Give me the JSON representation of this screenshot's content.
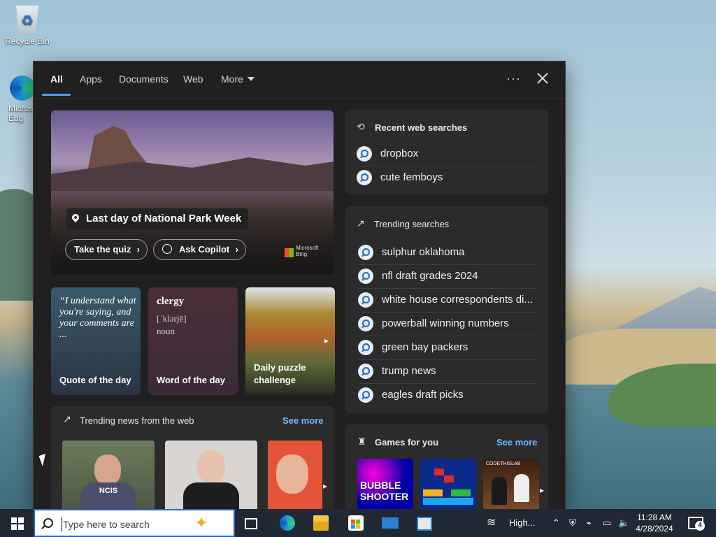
{
  "desktop": {
    "icons": [
      {
        "label": "Recycle Bin",
        "icon": "recycle-bin-icon"
      },
      {
        "label": "Microsoft Edge",
        "visible_text": "Micros\nEdg",
        "icon": "edge-icon"
      }
    ]
  },
  "search_panel": {
    "tabs": [
      {
        "label": "All",
        "active": true
      },
      {
        "label": "Apps"
      },
      {
        "label": "Documents"
      },
      {
        "label": "Web"
      },
      {
        "label": "More"
      }
    ],
    "more_options_glyph": "···",
    "hero": {
      "title": "Last day of National Park Week",
      "buttons": [
        {
          "label": "Take the quiz"
        },
        {
          "label": "Ask Copilot"
        }
      ],
      "brand": "Microsoft Bing"
    },
    "cards": [
      {
        "quote": "“I understand what you're saying, and your comments are ...",
        "caption": "Quote of the day"
      },
      {
        "word": "clergy",
        "pronunciation": "[ˈklərjē]",
        "part_of_speech": "noun",
        "caption": "Word of the day"
      },
      {
        "caption": "Daily puzzle challenge"
      }
    ],
    "recent": {
      "title": "Recent web searches",
      "items": [
        "dropbox",
        "cute femboys"
      ]
    },
    "trending": {
      "title": "Trending searches",
      "items": [
        "sulphur oklahoma",
        "nfl draft grades 2024",
        "white house correspondents di...",
        "powerball winning numbers",
        "green bay packers",
        "trump news",
        "eagles draft picks"
      ]
    },
    "news": {
      "title": "Trending news from the web",
      "see_more": "See more",
      "thumb_texts": [
        "NCIS"
      ]
    },
    "games": {
      "title": "Games for you",
      "see_more": "See more",
      "thumb_texts": [
        "BUBBLE SHOOTER",
        "CODETHISLAB"
      ]
    }
  },
  "taskbar": {
    "search_placeholder": "Type here to search",
    "weather": "High...",
    "time": "11:28 AM",
    "date": "4/28/2024",
    "notification_count": "4"
  },
  "colors": {
    "accent": "#4aa3ff",
    "link": "#6cb6ff",
    "panel_bg": "#202020",
    "box_bg": "#2b2b2b",
    "taskbar_bg": "#1f2833"
  }
}
